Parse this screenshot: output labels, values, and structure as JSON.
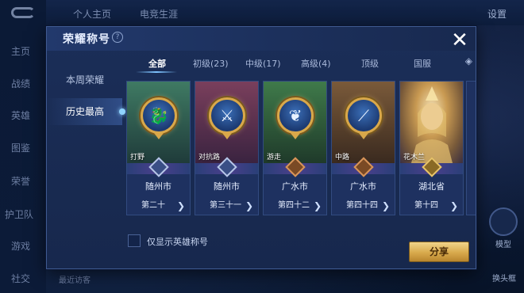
{
  "background": {
    "left_nav": [
      "主页",
      "战绩",
      "英雄",
      "图鉴",
      "荣誉",
      "护卫队",
      "游戏",
      "社交"
    ],
    "top_tabs": [
      "个人主页",
      "电竞生涯"
    ],
    "settings_label": "设置",
    "bottom_left_text": "最近访客",
    "bottom_right_labels": [
      "模型",
      "换头框"
    ]
  },
  "dialog": {
    "title": "荣耀称号",
    "help_icon": "?",
    "close_icon": "✕"
  },
  "side_nav": [
    {
      "label": "本周荣耀",
      "active": false
    },
    {
      "label": "历史最高",
      "active": true
    }
  ],
  "tabs": [
    {
      "label": "全部",
      "active": true
    },
    {
      "label": "初级(23)",
      "active": false
    },
    {
      "label": "中级(17)",
      "active": false
    },
    {
      "label": "高级(4)",
      "active": false
    },
    {
      "label": "顶级",
      "active": false
    },
    {
      "label": "国服",
      "active": false
    }
  ],
  "cards": [
    {
      "role": "打野",
      "region": "随州市",
      "rank": "第二十",
      "badge": "silver",
      "emblem_icon": "dragon-icon",
      "art": "#2c5a4a"
    },
    {
      "role": "对抗路",
      "region": "随州市",
      "rank": "第三十一",
      "badge": "silver",
      "emblem_icon": "swords-icon",
      "art": "#5b2f4a"
    },
    {
      "role": "游走",
      "region": "广水市",
      "rank": "第四十二",
      "badge": "bronze",
      "emblem_icon": "wings-icon",
      "art": "#2b5a3a"
    },
    {
      "role": "中路",
      "region": "广水市",
      "rank": "第四十四",
      "badge": "bronze",
      "emblem_icon": "staff-icon",
      "art": "#5a3f2a"
    },
    {
      "role": "花木兰",
      "region": "湖北省",
      "rank": "第十四",
      "badge": "gold",
      "emblem_icon": "hero-portrait",
      "art": "#8a6a3a"
    }
  ],
  "filter_checkbox_label": "仅显示英雄称号",
  "share_button": "分享"
}
